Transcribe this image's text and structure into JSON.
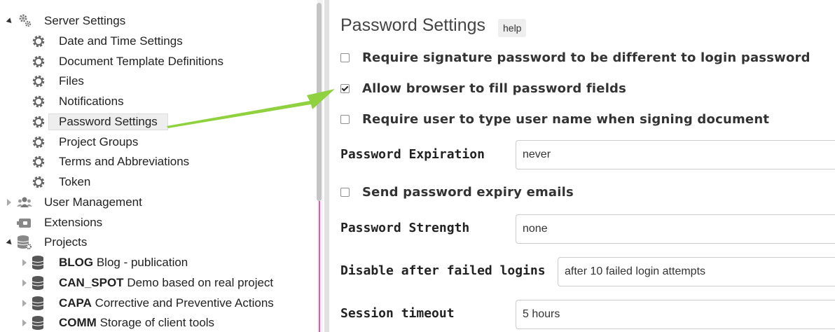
{
  "tree": {
    "server_settings": "Server Settings",
    "children": [
      {
        "label": "Date and Time Settings"
      },
      {
        "label": "Document Template Definitions"
      },
      {
        "label": "Files"
      },
      {
        "label": "Notifications"
      },
      {
        "label": "Password Settings",
        "selected": true
      },
      {
        "label": "Project Groups"
      },
      {
        "label": "Terms and Abbreviations"
      },
      {
        "label": "Token"
      }
    ],
    "user_management": "User Management",
    "extensions": "Extensions",
    "projects": "Projects",
    "project_items": [
      {
        "code": "BLOG",
        "name": "Blog - publication"
      },
      {
        "code": "CAN_SPOT",
        "name": "Demo based on real project"
      },
      {
        "code": "CAPA",
        "name": "Corrective and Preventive Actions"
      },
      {
        "code": "COMM",
        "name": "Storage of client tools"
      }
    ]
  },
  "panel": {
    "title": "Password Settings",
    "help": "help",
    "options": {
      "different_password": {
        "label": "Require signature password to be different to login password",
        "checked": false
      },
      "browser_fill": {
        "label": "Allow browser to fill password fields",
        "checked": true
      },
      "type_username": {
        "label": "Require user to type user name when signing document",
        "checked": false
      },
      "expiry_emails": {
        "label": "Send password expiry emails",
        "checked": false
      }
    },
    "fields": {
      "expiration": {
        "label": "Password Expiration",
        "value": "never"
      },
      "strength": {
        "label": "Password Strength",
        "value": "none"
      },
      "failed_logins": {
        "label": "Disable after failed logins",
        "value": "after 10 failed login attempts"
      },
      "session_timeout": {
        "label": "Session timeout",
        "value": "5 hours"
      }
    }
  },
  "colors": {
    "arrow": "#8fd13f",
    "selection_bg": "#eeeeee",
    "scroll_accent": "#e05aa8"
  },
  "icons": {
    "server_settings": "gears-icon",
    "child": "gear-icon",
    "user_management": "users-icon",
    "extensions": "plugin-icon",
    "projects": "database-gear-icon",
    "project": "database-icon"
  }
}
